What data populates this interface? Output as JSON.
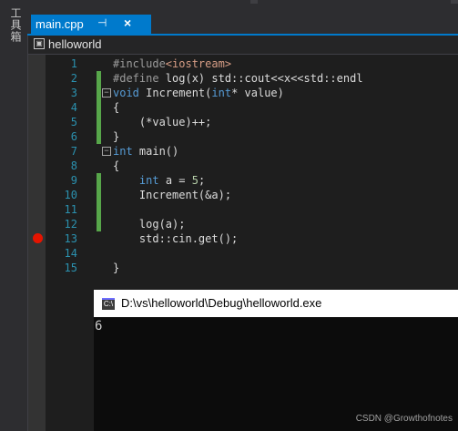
{
  "toolbox": {
    "label": "工具箱"
  },
  "tab": {
    "title": "main.cpp",
    "pin_glyph": "⊣",
    "close_glyph": "×"
  },
  "navbar": {
    "project": "helloworld"
  },
  "editor": {
    "lines": [
      {
        "num": "1",
        "text": "#include<iostream>"
      },
      {
        "num": "2",
        "text": "#define log(x) std::cout<<x<<std::endl"
      },
      {
        "num": "3",
        "text": "void Increment(int* value)"
      },
      {
        "num": "4",
        "text": "{"
      },
      {
        "num": "5",
        "text": "    (*value)++;"
      },
      {
        "num": "6",
        "text": "}"
      },
      {
        "num": "7",
        "text": "int main()"
      },
      {
        "num": "8",
        "text": "{"
      },
      {
        "num": "9",
        "text": "    int a = 5;"
      },
      {
        "num": "10",
        "text": "    Increment(&a);"
      },
      {
        "num": "11",
        "text": ""
      },
      {
        "num": "12",
        "text": "    log(a);"
      },
      {
        "num": "13",
        "text": "    std::cin.get();"
      },
      {
        "num": "14",
        "text": ""
      },
      {
        "num": "15",
        "text": "}"
      }
    ],
    "breakpoint_line": "13"
  },
  "console": {
    "title": "D:\\vs\\helloworld\\Debug\\helloworld.exe",
    "output": "6"
  },
  "watermark": "CSDN @Growthofnotes",
  "colors": {
    "accent": "#007acc",
    "change": "#57a64a",
    "breakpoint": "#e51400"
  }
}
